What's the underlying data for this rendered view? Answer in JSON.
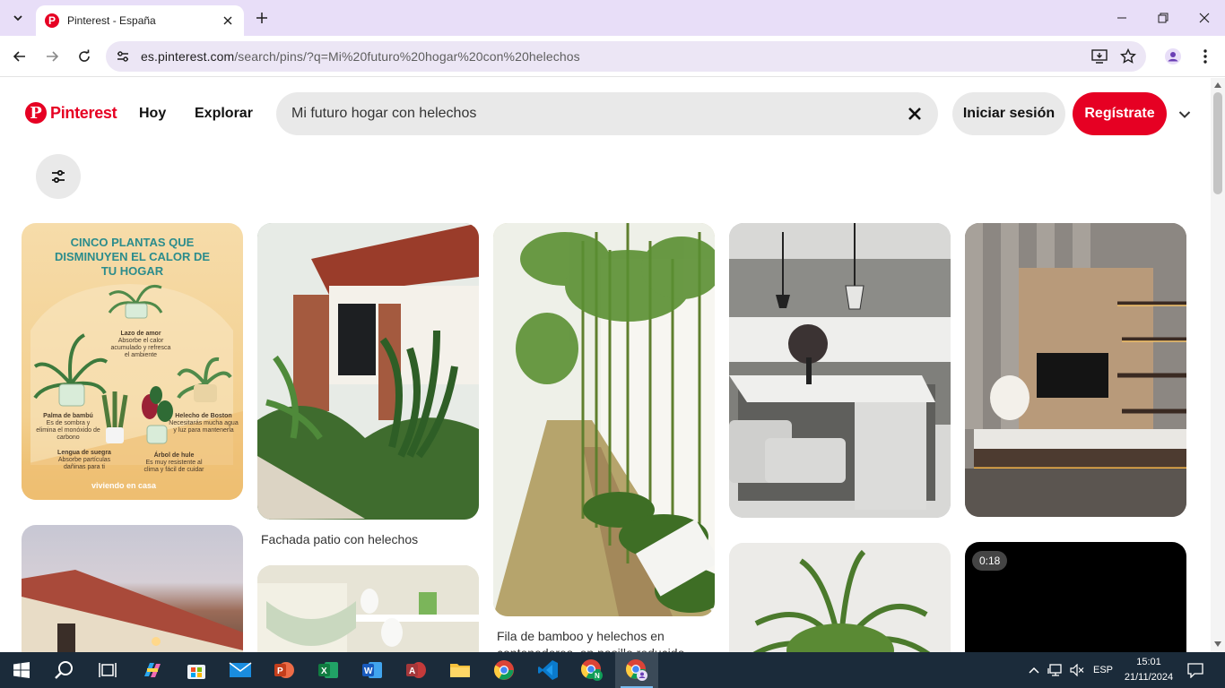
{
  "browser": {
    "tab_title": "Pinterest - España",
    "url_host": "es.pinterest.com",
    "url_path": "/search/pins/?q=Mi%20futuro%20hogar%20con%20helechos"
  },
  "header": {
    "logo": "Pinterest",
    "nav_today": "Hoy",
    "nav_explore": "Explorar",
    "search_value": "Mi futuro hogar con helechos",
    "login": "Iniciar sesión",
    "signup": "Regístrate"
  },
  "pins": {
    "infographic": {
      "title": "CINCO PLANTAS QUE DISMINUYEN EL CALOR DE TU HOGAR",
      "lazo_title": "Lazo de amor",
      "lazo_text": "Absorbe el calor acumulado y refresca el ambiente",
      "palma_title": "Palma de bambú",
      "palma_text": "Es de sombra y elimina el monóxido de carbono",
      "helecho_title": "Helecho de Boston",
      "helecho_text": "Necesitarás mucha agua y luz para mantenerla",
      "lengua_title": "Lengua de suegra",
      "lengua_text": "Absorbe partículas dañinas para ti",
      "arbol_title": "Árbol de hule",
      "arbol_text": "Es muy resistente al clima y fácil de cuidar",
      "brand": "viviendo en casa"
    },
    "patio_caption": "Fachada patio con helechos",
    "bamboo_caption": "Fila de bamboo y helechos en contenedores, en pasillo reducido",
    "video_duration": "0:18"
  },
  "taskbar": {
    "lang": "ESP",
    "time": "15:01",
    "date": "21/11/2024"
  }
}
